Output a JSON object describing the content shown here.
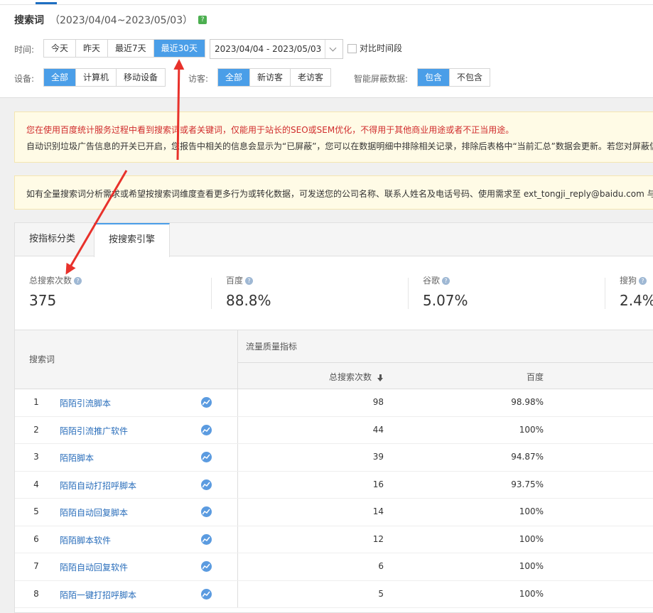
{
  "header": {
    "title": "搜索词",
    "range": "（2023/04/04~2023/05/03）",
    "help_icon": "?"
  },
  "time": {
    "label": "时间:",
    "options": [
      "今天",
      "昨天",
      "最近7天",
      "最近30天"
    ],
    "selected": "最近30天",
    "date_range": "2023/04/04 - 2023/05/03",
    "compare_label": "对比时间段"
  },
  "device": {
    "label": "设备:",
    "options": [
      "全部",
      "计算机",
      "移动设备"
    ],
    "selected": "全部"
  },
  "visitor": {
    "label": "访客:",
    "options": [
      "全部",
      "新访客",
      "老访客"
    ],
    "selected": "全部"
  },
  "smart_block": {
    "label": "智能屏蔽数据:",
    "options": [
      "包含",
      "不包含"
    ],
    "selected": "包含"
  },
  "notice": {
    "warning": "您在使用百度统计服务过程中看到搜索词或者关键词，仅能用于站长的SEO或SEM优化，不得用于其他商业用途或者不正当用途。",
    "info": "自动识别垃圾广告信息的开关已开启，您报告中相关的信息会显示为“已屏蔽”，您可以在数据明细中排除相关记录，排除后表格中“当前汇总”数据会更新。若您对屏蔽信",
    "contact": "如有全量搜索词分析需求或希望按搜索词维度查看更多行为或转化数据，可发送您的公司名称、联系人姓名及电话号码、使用需求至 ext_tongji_reply@baidu.com 与我们"
  },
  "tabs": [
    {
      "label": "按指标分类",
      "active": false
    },
    {
      "label": "按搜索引擎",
      "active": true
    }
  ],
  "metrics": [
    {
      "label": "总搜索次数",
      "value": "375"
    },
    {
      "label": "百度",
      "value": "88.8%"
    },
    {
      "label": "谷歌",
      "value": "5.07%"
    },
    {
      "label": "搜狗",
      "value": "2.4%"
    }
  ],
  "table": {
    "kw_header": "搜索词",
    "group_header": "流量质量指标",
    "col1": "总搜索次数",
    "col2": "百度",
    "rows": [
      {
        "idx": "1",
        "kw": "陌陌引流脚本",
        "total": "98",
        "baidu": "98.98%"
      },
      {
        "idx": "2",
        "kw": "陌陌引流推广软件",
        "total": "44",
        "baidu": "100%"
      },
      {
        "idx": "3",
        "kw": "陌陌脚本",
        "total": "39",
        "baidu": "94.87%"
      },
      {
        "idx": "4",
        "kw": "陌陌自动打招呼脚本",
        "total": "16",
        "baidu": "93.75%"
      },
      {
        "idx": "5",
        "kw": "陌陌自动回复脚本",
        "total": "14",
        "baidu": "100%"
      },
      {
        "idx": "6",
        "kw": "陌陌脚本软件",
        "total": "12",
        "baidu": "100%"
      },
      {
        "idx": "7",
        "kw": "陌陌自动回复软件",
        "total": "6",
        "baidu": "100%"
      },
      {
        "idx": "8",
        "kw": "陌陌一键打招呼脚本",
        "total": "5",
        "baidu": "100%"
      }
    ]
  },
  "colors": {
    "accent": "#4a9ee8",
    "link": "#2a6ebb",
    "warning_text": "#d02c2c",
    "annotation_arrow": "#e8312b"
  },
  "icons": [
    "help-icon",
    "chevron-down-icon",
    "sort-desc-icon",
    "trend-icon",
    "annotation-arrow"
  ]
}
